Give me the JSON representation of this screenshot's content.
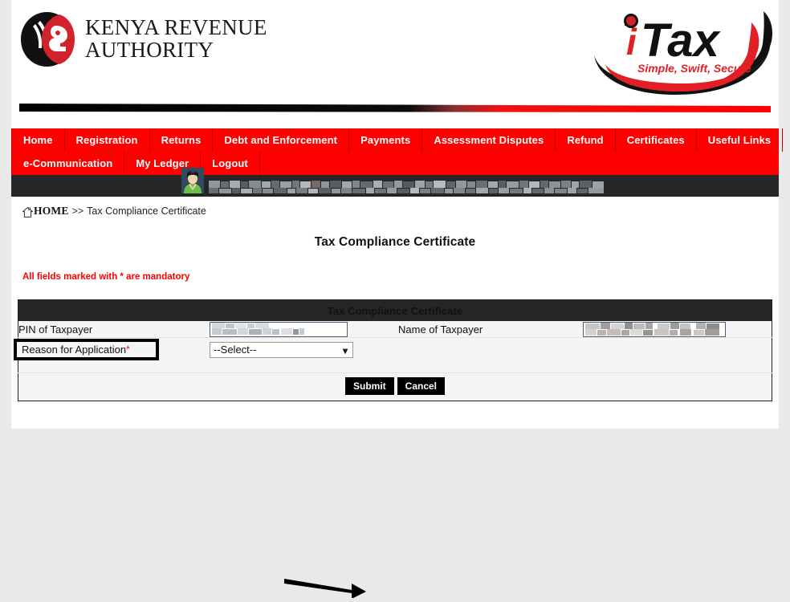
{
  "brand": {
    "kra_line1": "KENYA REVENUE",
    "kra_line2": "AUTHORITY",
    "itax_name": "iTax",
    "itax_tagline": "Simple, Swift, Secure",
    "accent_red": "#fb0100",
    "dark": "#262626"
  },
  "nav": {
    "row1": [
      {
        "label": "Home"
      },
      {
        "label": "Registration"
      },
      {
        "label": "Returns"
      },
      {
        "label": "Debt and Enforcement"
      },
      {
        "label": "Payments"
      },
      {
        "label": "Assessment Disputes"
      },
      {
        "label": "Refund"
      },
      {
        "label": "Certificates"
      },
      {
        "label": "Useful Links"
      }
    ],
    "row2": [
      {
        "label": "e-Communication"
      },
      {
        "label": "My Ledger"
      },
      {
        "label": "Logout"
      }
    ]
  },
  "userbar": {
    "avatar_icon": "user-avatar-icon",
    "username_redacted": ""
  },
  "breadcrumb": {
    "home_icon": "home-icon",
    "home_label": "HOME",
    "separator": ">>",
    "current": "Tax Compliance Certificate"
  },
  "main": {
    "page_title": "Tax Compliance Certificate",
    "mandatory_note": "All fields marked with * are mandatory"
  },
  "form": {
    "section_title": "Tax Compliance Certificate",
    "fields": {
      "pin_label": "PIN of Taxpayer",
      "pin_value": "",
      "name_label": "Name of Taxpayer",
      "name_value": "",
      "reason_label": "Reason for Application",
      "reason_required_mark": "*",
      "reason_value": "--Select--",
      "reason_caret": "chevron-down-icon"
    },
    "buttons": {
      "submit": "Submit",
      "cancel": "Cancel"
    }
  },
  "annotations": {
    "arrow": "arrow-pointing-to-submit"
  }
}
